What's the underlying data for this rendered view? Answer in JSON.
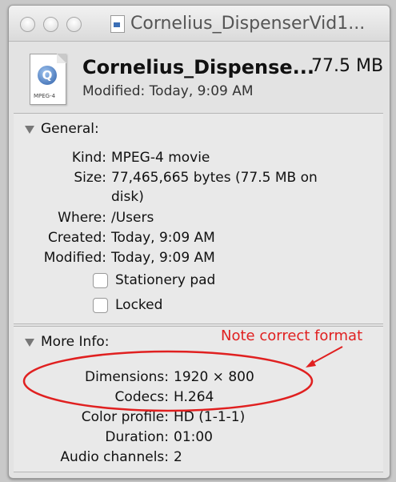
{
  "window": {
    "title": "Cornelius_DispenserVid1..."
  },
  "file": {
    "name": "Cornelius_Dispense...",
    "size": "77.5 MB",
    "modified": "Modified: Today, 9:09 AM",
    "icon_tag": "MPEG-4",
    "icon": "quicktime-movie-icon"
  },
  "general": {
    "header": "General:",
    "rows": [
      {
        "label": "Kind:",
        "value": "MPEG-4 movie"
      },
      {
        "label": "Size:",
        "value": "77,465,665 bytes (77.5 MB on",
        "value2": "disk)"
      },
      {
        "label": "Where:",
        "value": "/Users"
      },
      {
        "label": "Created:",
        "value": "Today, 9:09 AM"
      },
      {
        "label": "Modified:",
        "value": "Today, 9:09 AM"
      }
    ],
    "stationery": {
      "label": "Stationery pad",
      "checked": false
    },
    "locked": {
      "label": "Locked",
      "checked": false
    }
  },
  "more_info": {
    "header": "More Info:",
    "rows": [
      {
        "label": "Dimensions:",
        "value": "1920 × 800"
      },
      {
        "label": "Codecs:",
        "value": "H.264"
      },
      {
        "label": "Color profile:",
        "value": "HD (1-1-1)"
      },
      {
        "label": "Duration:",
        "value": "01:00"
      },
      {
        "label": "Audio channels:",
        "value": "2"
      }
    ]
  },
  "annotation": {
    "text": "Note correct format",
    "color": "#e02020"
  }
}
